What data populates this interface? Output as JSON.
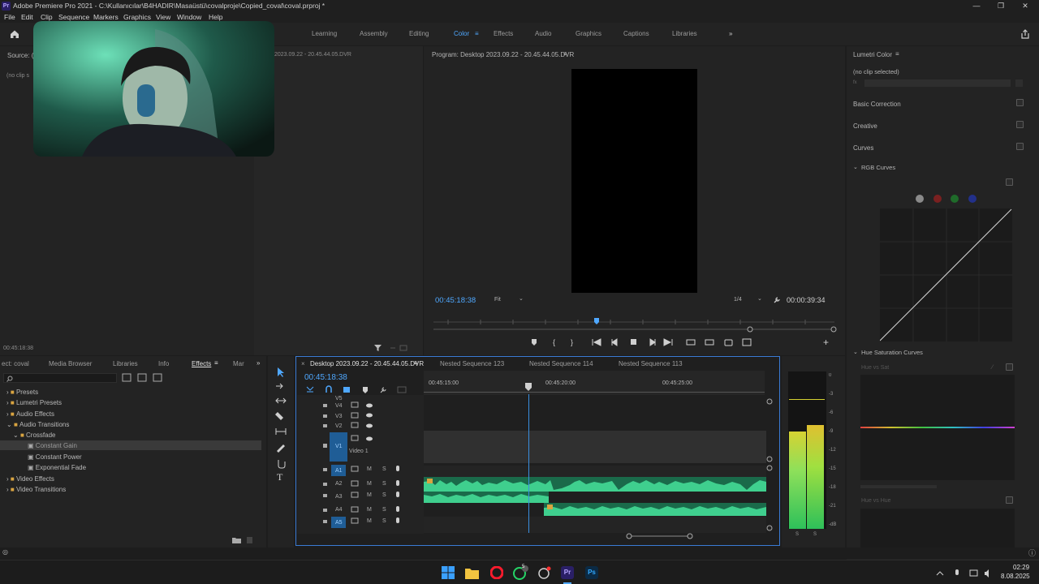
{
  "titlebar": {
    "title": "Adobe Premiere Pro 2021 - C:\\Kullanıcılar\\B4HADIR\\Masaüstü\\covalproje\\Copied_coval\\coval.prproj *",
    "logo": "Pr"
  },
  "menu": [
    "File",
    "Edit",
    "Clip",
    "Sequence",
    "Markers",
    "Graphics",
    "View",
    "Window",
    "Help"
  ],
  "workspaces": [
    {
      "label": "Learning"
    },
    {
      "label": "Assembly"
    },
    {
      "label": "Editing"
    },
    {
      "label": "Color",
      "active": true
    },
    {
      "label": "Effects"
    },
    {
      "label": "Audio"
    },
    {
      "label": "Graphics"
    },
    {
      "label": "Captions"
    },
    {
      "label": "Libraries"
    }
  ],
  "source_panel": {
    "title": "Source: (n",
    "no_clip": "(no clip s",
    "source_clip_name": "2023.09.22 - 20.45.44.05.DVR",
    "timecode": "00:45:18:38"
  },
  "program_monitor": {
    "title": "Program: Desktop 2023.09.22 - 20.45.44.05.DVR",
    "timecode": "00:45:18:38",
    "fit": "Fit",
    "resolution": "1/4",
    "duration": "00:00:39:34"
  },
  "lumetri": {
    "title": "Lumetri Color",
    "no_clip": "(no clip selected)",
    "fx": "fx",
    "sections": [
      "Basic Correction",
      "Creative",
      "Curves"
    ],
    "rgb_curves": "RGB Curves",
    "hue_sat_curves": "Hue Saturation Curves",
    "hue_vs_sat": "Hue vs Sat",
    "hue_vs_hue": "Hue vs Hue",
    "channel_colors": [
      "#8a8a8a",
      "#7a2020",
      "#1f6b2a",
      "#22308a"
    ]
  },
  "effects_panel": {
    "tabs": [
      "ect: coval",
      "Media Browser",
      "Libraries",
      "Info",
      "Effects",
      "Mar"
    ],
    "active_tab": "Effects",
    "tree": [
      {
        "label": "Presets",
        "level": 0
      },
      {
        "label": "Lumetri Presets",
        "level": 0
      },
      {
        "label": "Audio Effects",
        "level": 0
      },
      {
        "label": "Audio Transitions",
        "level": 0,
        "open": true
      },
      {
        "label": "Crossfade",
        "level": 1,
        "open": true
      },
      {
        "label": "Constant Gain",
        "level": 2,
        "selected": true
      },
      {
        "label": "Constant Power",
        "level": 2
      },
      {
        "label": "Exponential Fade",
        "level": 2
      },
      {
        "label": "Video Effects",
        "level": 0
      },
      {
        "label": "Video Transitions",
        "level": 0
      }
    ]
  },
  "timeline": {
    "tabs": [
      {
        "label": "Desktop 2023.09.22 - 20.45.44.05.DVR",
        "active": true
      },
      {
        "label": "Nested Sequence 123"
      },
      {
        "label": "Nested Sequence 114"
      },
      {
        "label": "Nested Sequence 113"
      }
    ],
    "timecode": "00:45:18:38",
    "ruler": [
      "00:45:15:00",
      "00:45:20:00",
      "00:45:25:00"
    ],
    "video_tracks": [
      "V5",
      "V4",
      "V3",
      "V2",
      "V1"
    ],
    "v1_name": "Video 1",
    "audio_tracks": [
      "A1",
      "A2",
      "A3",
      "A4",
      "A5"
    ],
    "mute": "M",
    "solo": "S",
    "fx_badge": "fx"
  },
  "audio_meter": {
    "scale": [
      "0",
      "-3",
      "-6",
      "-9",
      "-12",
      "-15",
      "-18",
      "-21",
      "-dB"
    ],
    "solo_labels": [
      "S",
      "S"
    ],
    "levels": [
      0.62,
      0.66
    ]
  },
  "taskbar": {
    "time": "02:29",
    "date": "8.08.2025",
    "notif": "5"
  }
}
